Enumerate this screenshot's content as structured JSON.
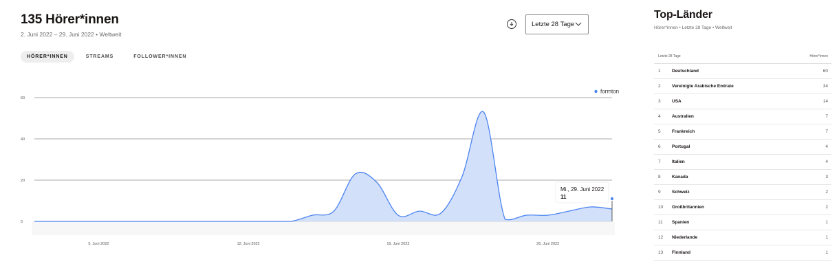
{
  "header": {
    "title": "135 Hörer*innen",
    "subtitle": "2. Juni 2022 – 29. Juni 2022 • Weltweit"
  },
  "controls": {
    "download_icon": "download-circle-icon",
    "range_label": "Letzte 28 Tage",
    "range_icon": "chevron-down-icon"
  },
  "tabs": [
    {
      "label": "HÖRER*INNEN",
      "active": true
    },
    {
      "label": "STREAMS",
      "active": false
    },
    {
      "label": "FOLLOWER*INNEN",
      "active": false
    }
  ],
  "chart_data": {
    "type": "area",
    "series": [
      {
        "name": "formton",
        "color": "#4c84f0",
        "fill": "#d2e0fa",
        "x": [
          "2022-06-02",
          "2022-06-03",
          "2022-06-04",
          "2022-06-05",
          "2022-06-06",
          "2022-06-07",
          "2022-06-08",
          "2022-06-09",
          "2022-06-10",
          "2022-06-11",
          "2022-06-12",
          "2022-06-13",
          "2022-06-14",
          "2022-06-15",
          "2022-06-16",
          "2022-06-17",
          "2022-06-18",
          "2022-06-19",
          "2022-06-20",
          "2022-06-21",
          "2022-06-22",
          "2022-06-23",
          "2022-06-24",
          "2022-06-25",
          "2022-06-26",
          "2022-06-27",
          "2022-06-28",
          "2022-06-29"
        ],
        "values": [
          0,
          0,
          0,
          0,
          0,
          0,
          0,
          0,
          0,
          0,
          0,
          0,
          0,
          3,
          5,
          23,
          19,
          3,
          5,
          4,
          22,
          53,
          1,
          3,
          3,
          5,
          7,
          6
        ]
      }
    ],
    "x_tick_labels": [
      "5. Juni 2022",
      "12. Juni 2022",
      "19. Juni 2022",
      "26. Juni 2022"
    ],
    "x_tick_dates": [
      "2022-06-05",
      "2022-06-12",
      "2022-06-19",
      "2022-06-26"
    ],
    "y_ticks": [
      0,
      20,
      40,
      60
    ],
    "ylim": [
      0,
      60
    ],
    "grid": true,
    "legend": {
      "position": "top-right",
      "label": "formton"
    },
    "tooltip": {
      "date": "Mi., 29. Juni 2022",
      "value": "11",
      "target_x": "2022-06-29",
      "target_y": 11
    }
  },
  "top_countries": {
    "title": "Top-Länder",
    "subtitle": "Hörer*innen • Letzte 28 Tage • Weltweit",
    "col_left": "Letzte 28 Tage",
    "col_right": "Hörer*innen",
    "rows": [
      {
        "rank": "1",
        "country": "Deutschland",
        "value": "60"
      },
      {
        "rank": "2",
        "country": "Vereinigte Arabische Emirate",
        "value": "34"
      },
      {
        "rank": "3",
        "country": "USA",
        "value": "14"
      },
      {
        "rank": "4",
        "country": "Australien",
        "value": "7"
      },
      {
        "rank": "5",
        "country": "Frankreich",
        "value": "7"
      },
      {
        "rank": "6",
        "country": "Portugal",
        "value": "4"
      },
      {
        "rank": "7",
        "country": "Italien",
        "value": "4"
      },
      {
        "rank": "8",
        "country": "Kanada",
        "value": "3"
      },
      {
        "rank": "9",
        "country": "Schweiz",
        "value": "2"
      },
      {
        "rank": "10",
        "country": "Großbritannien",
        "value": "2"
      },
      {
        "rank": "11",
        "country": "Spanien",
        "value": "1"
      },
      {
        "rank": "12",
        "country": "Niederlande",
        "value": "1"
      },
      {
        "rank": "13",
        "country": "Finnland",
        "value": "1"
      }
    ]
  }
}
